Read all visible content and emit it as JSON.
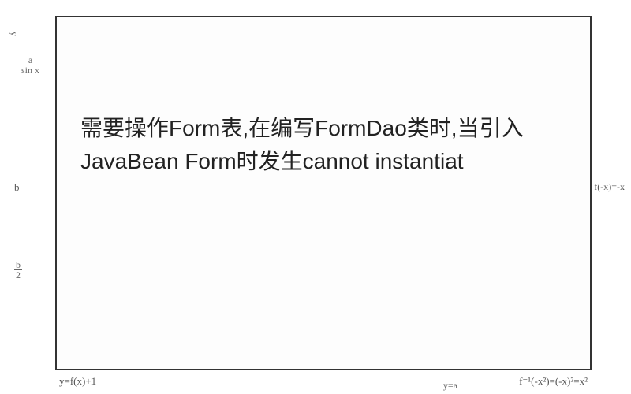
{
  "main_text": "需要操作Form表,在编写FormDao类时,当引入JavaBean Form时发生cannot instantiat",
  "axis": {
    "left_y": "y",
    "left_frac_top": "a",
    "left_frac_bot": "sin x",
    "left_b": "b",
    "left_b_frac_top": "b",
    "left_b_frac_bot": "2"
  },
  "formulas": {
    "bottom_left": "y=f(x)+1",
    "bottom_right": "f⁻¹(-x²)=(-x)²=x²",
    "right_side": "f(-x)=-x",
    "bottom_axis": "y=a"
  }
}
